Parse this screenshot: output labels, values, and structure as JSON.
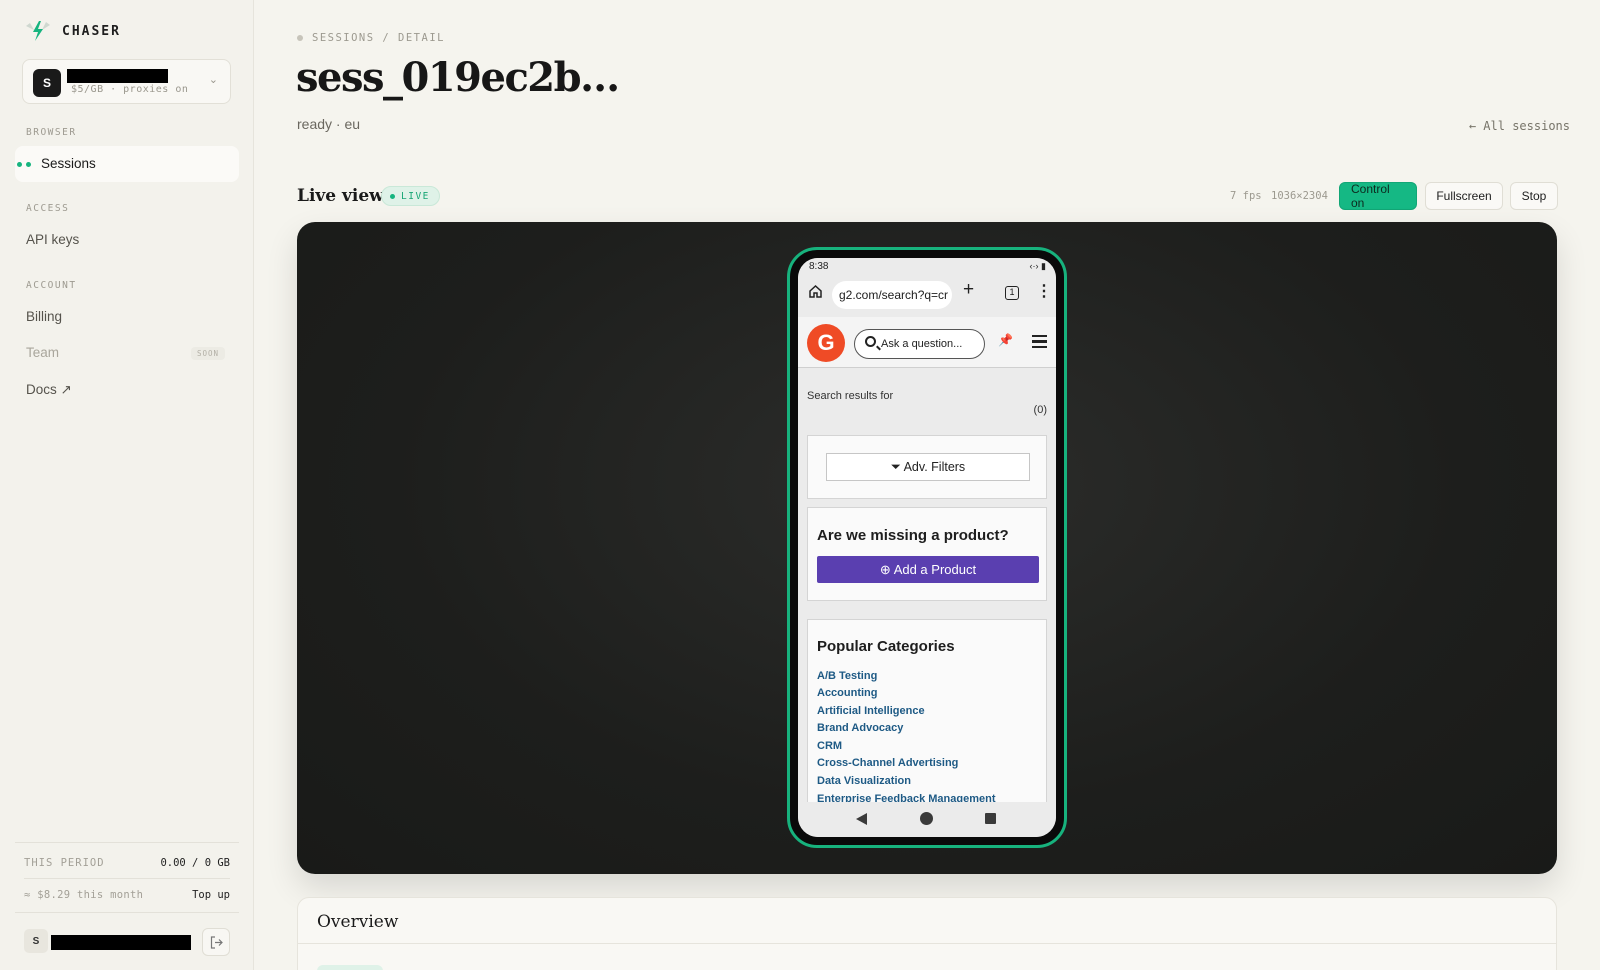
{
  "brand": {
    "name": "CHASER",
    "accent": "#16b47f"
  },
  "workspace": {
    "avatar": "S",
    "meta": "$5/GB · proxies on"
  },
  "nav": {
    "browser_section": "BROWSER",
    "sessions": "Sessions",
    "access_section": "ACCESS",
    "api_keys": "API keys",
    "account_section": "ACCOUNT",
    "billing": "Billing",
    "team": "Team",
    "team_badge": "SOON",
    "docs": "Docs ↗"
  },
  "usage": {
    "period_label": "THIS PERIOD",
    "period_value": "0.00 / 0 GB",
    "cost": "≈ $8.29 this month",
    "top_up": "Top up"
  },
  "user": {
    "avatar": "S"
  },
  "header": {
    "breadcrumb": "SESSIONS / DETAIL",
    "title": "sess_019ec2b…",
    "subtitle": "ready · eu",
    "all_sessions": "← All sessions"
  },
  "live": {
    "title": "Live view",
    "badge": "LIVE",
    "fps": "7 fps",
    "resolution": "1036×2304",
    "control_button": "Control on",
    "fullscreen_button": "Fullscreen",
    "stop_button": "Stop"
  },
  "phone": {
    "time": "8:38",
    "status_icons": "‹·› ▮",
    "url": "g2.com/search?q=cr",
    "tab_count": "1",
    "logo_text": "G",
    "search_placeholder": "Ask a question...",
    "results_label": "Search results for",
    "results_count": "(0)",
    "filters_button": "⏷ Adv. Filters",
    "missing_title": "Are we missing a product?",
    "add_product_button": "⊕ Add a Product",
    "popular_title": "Popular Categories",
    "categories": [
      "A/B Testing",
      "Accounting",
      "Artificial Intelligence",
      "Brand Advocacy",
      "CRM",
      "Cross-Channel Advertising",
      "Data Visualization",
      "Enterprise Feedback Management"
    ]
  },
  "overview": {
    "title": "Overview"
  }
}
